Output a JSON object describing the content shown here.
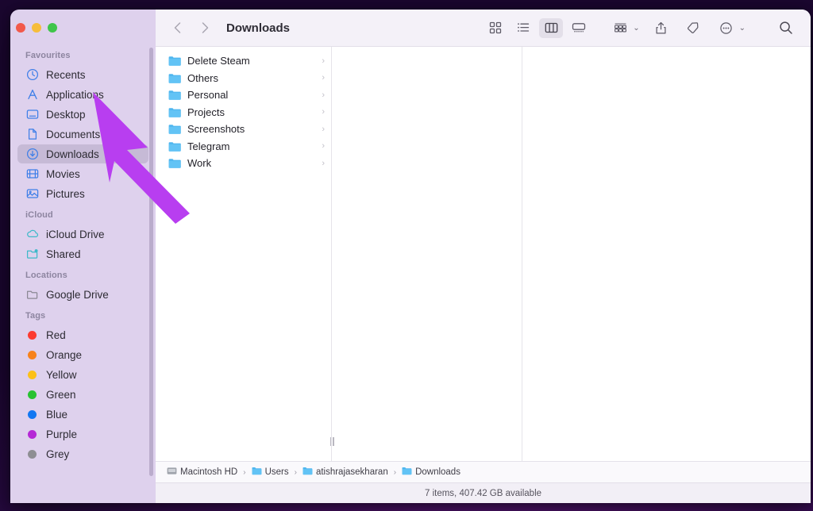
{
  "window": {
    "title": "Downloads",
    "traffic_lights": [
      "close",
      "minimize",
      "maximize"
    ]
  },
  "toolbar": {
    "back_label": "‹",
    "forward_label": "›",
    "view_modes": [
      {
        "name": "icon-view",
        "label": "Icon View",
        "active": false
      },
      {
        "name": "list-view",
        "label": "List View",
        "active": false
      },
      {
        "name": "column-view",
        "label": "Column View",
        "active": true
      },
      {
        "name": "gallery-view",
        "label": "Gallery View",
        "active": false
      }
    ],
    "group_by_label": "Group",
    "share_label": "Share",
    "tag_label": "Tags",
    "more_label": "More",
    "search_label": "Search"
  },
  "sidebar": {
    "groups": [
      {
        "title": "Favourites",
        "items": [
          {
            "label": "Recents",
            "icon": "clock-icon",
            "selected": false
          },
          {
            "label": "Applications",
            "icon": "applications-icon",
            "selected": false
          },
          {
            "label": "Desktop",
            "icon": "desktop-icon",
            "selected": false
          },
          {
            "label": "Documents",
            "icon": "document-icon",
            "selected": false
          },
          {
            "label": "Downloads",
            "icon": "download-icon",
            "selected": true
          },
          {
            "label": "Movies",
            "icon": "movies-icon",
            "selected": false
          },
          {
            "label": "Pictures",
            "icon": "pictures-icon",
            "selected": false
          }
        ]
      },
      {
        "title": "iCloud",
        "items": [
          {
            "label": "iCloud Drive",
            "icon": "cloud-icon",
            "selected": false
          },
          {
            "label": "Shared",
            "icon": "shared-folder-icon",
            "selected": false
          }
        ]
      },
      {
        "title": "Locations",
        "items": [
          {
            "label": "Google Drive",
            "icon": "folder-outline-icon",
            "selected": false
          }
        ]
      },
      {
        "title": "Tags",
        "items": [
          {
            "label": "Red",
            "icon": "tag-dot",
            "color": "#fc3b30",
            "selected": false
          },
          {
            "label": "Orange",
            "icon": "tag-dot",
            "color": "#f7821b",
            "selected": false
          },
          {
            "label": "Yellow",
            "icon": "tag-dot",
            "color": "#fcc018",
            "selected": false
          },
          {
            "label": "Green",
            "icon": "tag-dot",
            "color": "#28c231",
            "selected": false
          },
          {
            "label": "Blue",
            "icon": "tag-dot",
            "color": "#1277f2",
            "selected": false
          },
          {
            "label": "Purple",
            "icon": "tag-dot",
            "color": "#b528d6",
            "selected": false
          },
          {
            "label": "Grey",
            "icon": "tag-dot",
            "color": "#8e8e93",
            "selected": false
          }
        ]
      }
    ]
  },
  "file_list": {
    "items": [
      {
        "name": "Delete Steam",
        "type": "folder",
        "has_children": true
      },
      {
        "name": "Others",
        "type": "folder",
        "has_children": true
      },
      {
        "name": "Personal",
        "type": "folder",
        "has_children": true
      },
      {
        "name": "Projects",
        "type": "folder",
        "has_children": true
      },
      {
        "name": "Screenshots",
        "type": "folder",
        "has_children": true
      },
      {
        "name": "Telegram",
        "type": "folder",
        "has_children": true
      },
      {
        "name": "Work",
        "type": "folder",
        "has_children": true
      }
    ]
  },
  "breadcrumb": {
    "items": [
      {
        "label": "Macintosh HD",
        "icon": "harddisk-icon"
      },
      {
        "label": "Users",
        "icon": "folder-icon"
      },
      {
        "label": "atishrajasekharan",
        "icon": "folder-icon"
      },
      {
        "label": "Downloads",
        "icon": "folder-icon"
      }
    ],
    "separator": "›"
  },
  "status": {
    "text": "7 items, 407.42 GB available"
  },
  "annotation": {
    "arrow_color": "#b83ef0",
    "points_at": "Applications"
  }
}
